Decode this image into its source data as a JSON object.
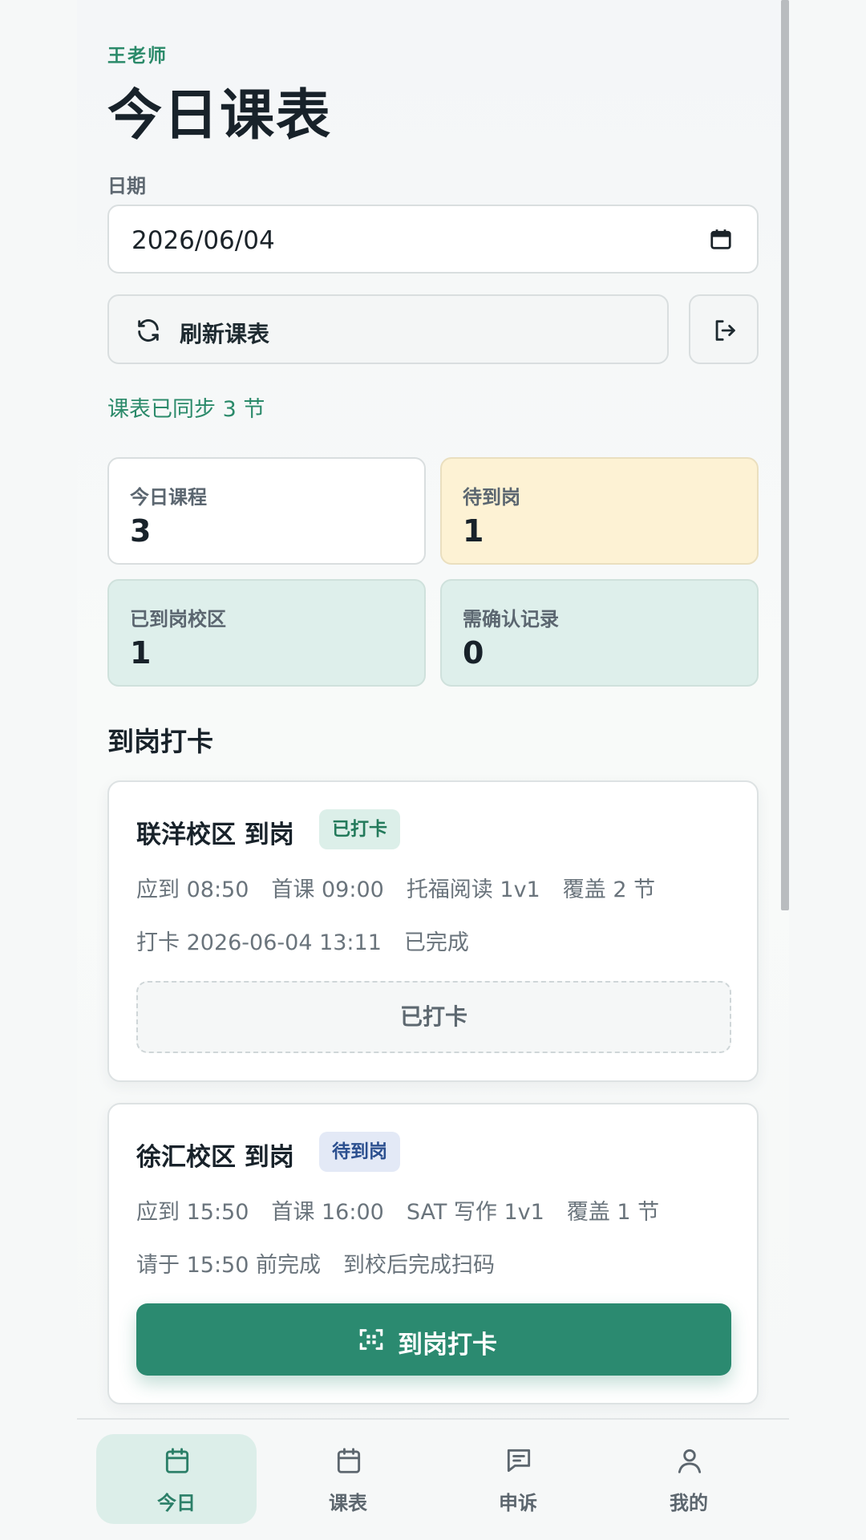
{
  "header": {
    "teacher_name": "王老师",
    "title": "今日课表"
  },
  "date_field": {
    "label": "日期",
    "value": "2026/06/04",
    "picker_icon": "calendar-icon"
  },
  "actions": {
    "refresh_label": "刷新课表",
    "refresh_icon": "refresh-icon",
    "logout_icon": "logout-icon"
  },
  "sync_status": "课表已同步 3 节",
  "stats": [
    {
      "label": "今日课程",
      "value": "3"
    },
    {
      "label": "待到岗",
      "value": "1"
    },
    {
      "label": "已到岗校区",
      "value": "1"
    },
    {
      "label": "需确认记录",
      "value": "0"
    }
  ],
  "section": {
    "title": "到岗打卡"
  },
  "checkins": [
    {
      "campus": "联洋校区 到岗",
      "badge": "已打卡",
      "line1": [
        "应到 08:50",
        "首课 09:00",
        "托福阅读 1v1",
        "覆盖 2 节"
      ],
      "line2": [
        "打卡 2026-06-04 13:11",
        "已完成"
      ],
      "action_label": "已打卡"
    },
    {
      "campus": "徐汇校区 到岗",
      "badge": "待到岗",
      "line1": [
        "应到 15:50",
        "首课 16:00",
        "SAT 写作 1v1",
        "覆盖 1 节"
      ],
      "line2": [
        "请于 15:50 前完成",
        "到校后完成扫码"
      ],
      "action_label": "到岗打卡",
      "action_icon": "scan-icon"
    }
  ],
  "nav": [
    {
      "label": "今日",
      "icon": "calendar-icon",
      "active": true
    },
    {
      "label": "课表",
      "icon": "calendar-icon",
      "active": false
    },
    {
      "label": "申诉",
      "icon": "message-icon",
      "active": false
    },
    {
      "label": "我的",
      "icon": "user-icon",
      "active": false
    }
  ],
  "colors": {
    "accent": "#2b8a70",
    "accent_text": "#2b8a6a",
    "warning_bg": "#fdf2d4",
    "teal_bg": "#deefeb",
    "pending_badge_bg": "#e3e9f6",
    "pending_badge_text": "#2b4f8f"
  }
}
